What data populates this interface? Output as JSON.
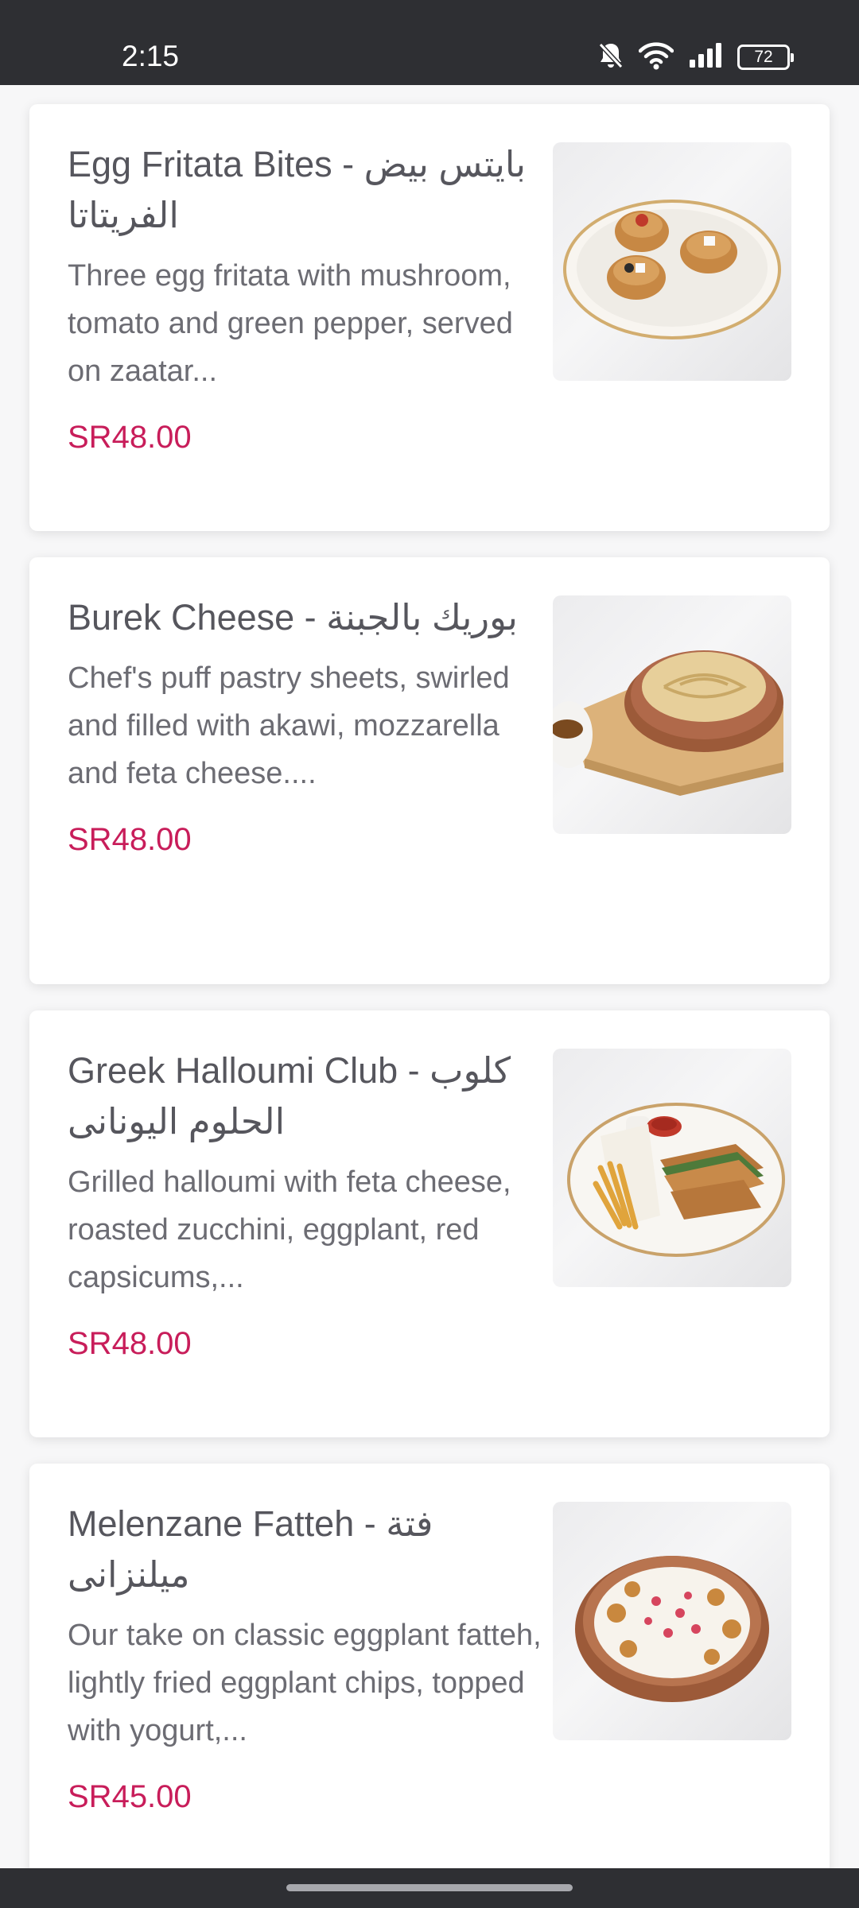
{
  "status_bar": {
    "time": "2:15",
    "battery": "72",
    "icons": [
      "bell-off-icon",
      "wifi-icon",
      "signal-icon",
      "battery-icon"
    ]
  },
  "menu_items": [
    {
      "title": "Egg Fritata Bites - بايتس بيض الفريتاتا",
      "description": "Three egg fritata with mushroom, tomato and green pepper, served on zaatar...",
      "price": "SR48.00"
    },
    {
      "title": "Burek Cheese - بوريك بالجبنة",
      "description": "Chef's puff pastry sheets, swirled and filled with akawi, mozzarella and feta cheese....",
      "price": "SR48.00"
    },
    {
      "title": "Greek Halloumi Club - كلوب الحلوم اليونانى",
      "description": "Grilled halloumi with feta cheese, roasted zucchini, eggplant, red capsicums,...",
      "price": "SR48.00"
    },
    {
      "title": "Melenzane Fatteh - فتة ميلنزانى",
      "description": "Our take on classic eggplant fatteh, lightly fried eggplant chips, topped with yogurt,...",
      "price": "SR45.00"
    }
  ],
  "colors": {
    "price": "#c81d5a",
    "title": "#56565d",
    "description": "#6c6c73",
    "system_bar": "#2e2f33"
  }
}
